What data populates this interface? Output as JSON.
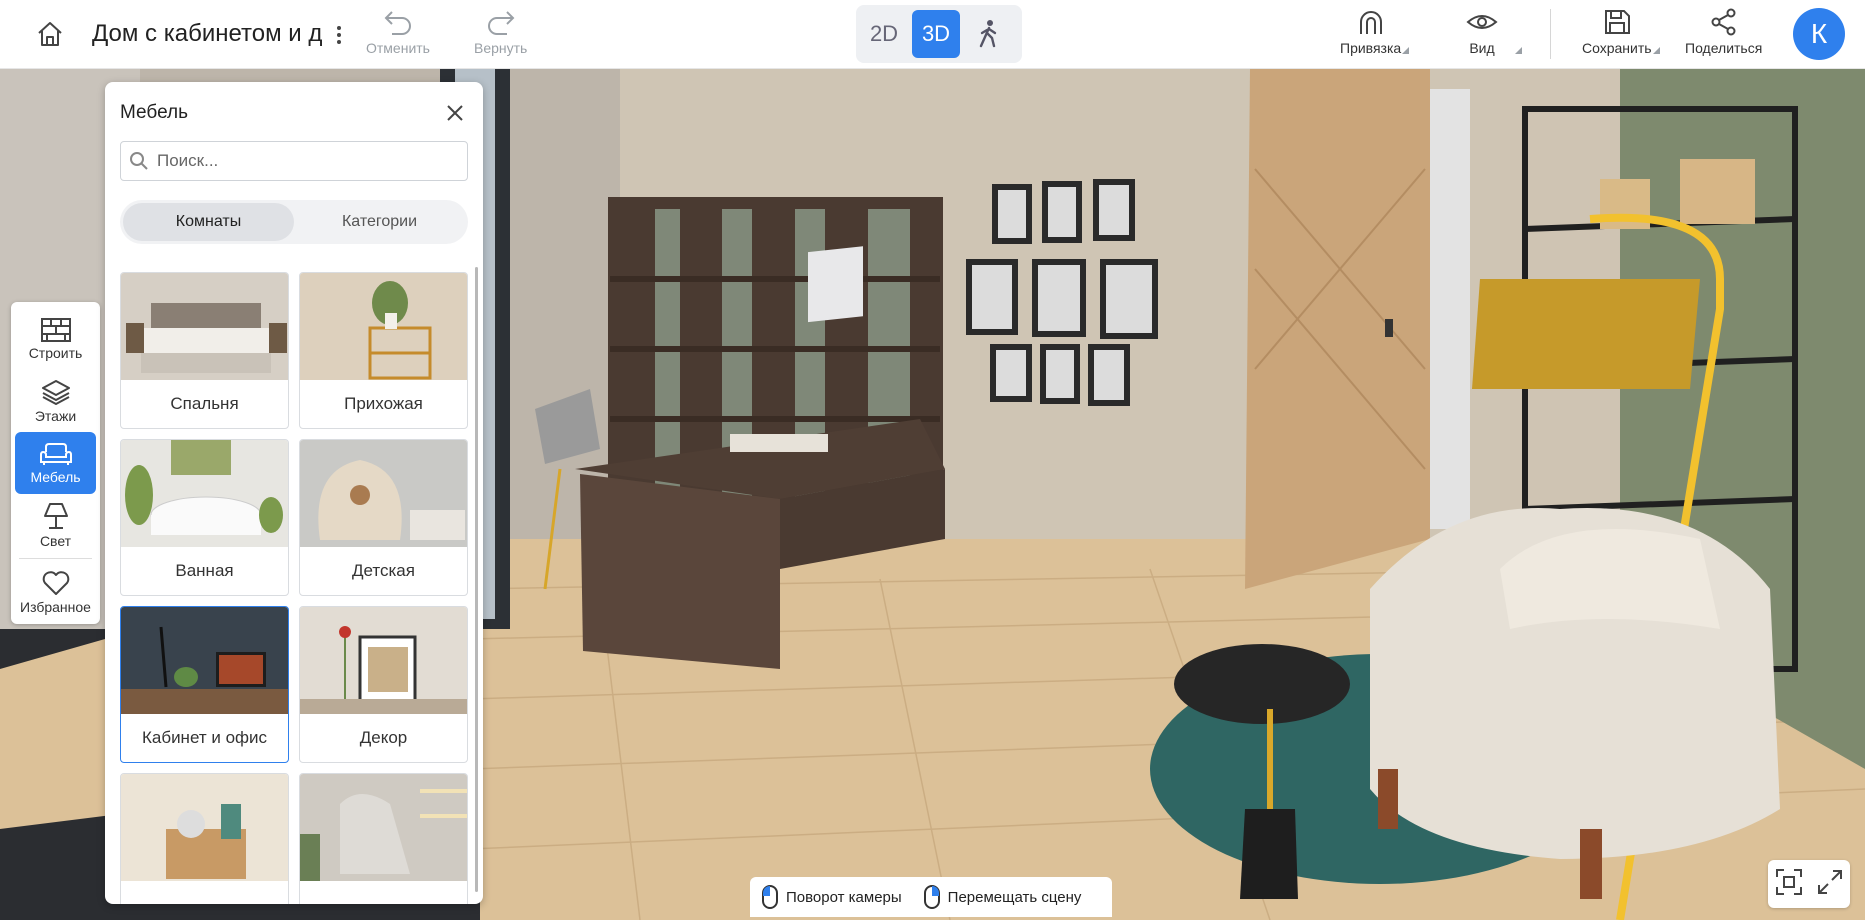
{
  "topbar": {
    "project_title": "Дом с кабинетом и д",
    "undo_label": "Отменить",
    "redo_label": "Вернуть",
    "view_modes": [
      "2D",
      "3D"
    ],
    "active_view_mode": "3D",
    "snap_label": "Привязка",
    "view_label": "Вид",
    "save_label": "Сохранить",
    "share_label": "Поделиться",
    "avatar_initial": "К",
    "accent_color": "#2f80ed"
  },
  "left_tools": {
    "items": [
      {
        "label": "Строить",
        "icon": "brick-wall-icon"
      },
      {
        "label": "Этажи",
        "icon": "layers-icon"
      },
      {
        "label": "Мебель",
        "icon": "sofa-icon",
        "active": true
      },
      {
        "label": "Свет",
        "icon": "lamp-icon"
      },
      {
        "label": "Избранное",
        "icon": "heart-icon"
      }
    ]
  },
  "panel": {
    "title": "Мебель",
    "search_placeholder": "Поиск...",
    "tabs": [
      "Комнаты",
      "Категории"
    ],
    "active_tab": "Комнаты",
    "cards": [
      {
        "label": "Спальня"
      },
      {
        "label": "Прихожая"
      },
      {
        "label": "Ванная"
      },
      {
        "label": "Детская"
      },
      {
        "label": "Кабинет и офис",
        "selected": true
      },
      {
        "label": "Декор"
      },
      {
        "label": ""
      },
      {
        "label": ""
      }
    ]
  },
  "hints": {
    "rotate_label": "Поворот камеры",
    "move_label": "Перемещать сцену"
  }
}
